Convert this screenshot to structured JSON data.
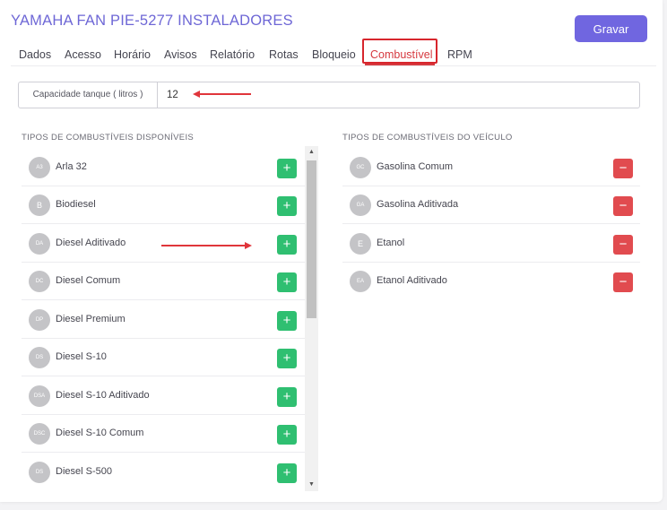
{
  "header": {
    "title": "YAMAHA FAN PIE-5277 INSTALADORES",
    "save_label": "Gravar"
  },
  "tabs": [
    {
      "label": "Dados"
    },
    {
      "label": "Acesso"
    },
    {
      "label": "Horário"
    },
    {
      "label": "Avisos"
    },
    {
      "label": "Relatório"
    },
    {
      "label": "Rotas"
    },
    {
      "label": "Bloqueio"
    },
    {
      "label": "Combustível",
      "active": true
    },
    {
      "label": "RPM"
    }
  ],
  "capacity": {
    "label": "Capacidade tanque ( litros )",
    "value": "12"
  },
  "available": {
    "title": "TIPOS DE COMBUSTÍVEIS DISPONÍVEIS",
    "items": [
      {
        "initials": "A3",
        "name": "Arla 32"
      },
      {
        "initials": "B",
        "name": "Biodiesel"
      },
      {
        "initials": "DA",
        "name": "Diesel Aditivado"
      },
      {
        "initials": "DC",
        "name": "Diesel Comum"
      },
      {
        "initials": "DP",
        "name": "Diesel Premium"
      },
      {
        "initials": "DS",
        "name": "Diesel S-10"
      },
      {
        "initials": "DSA",
        "name": "Diesel S-10 Aditivado"
      },
      {
        "initials": "DSC",
        "name": "Diesel S-10 Comum"
      },
      {
        "initials": "DS",
        "name": "Diesel S-500"
      }
    ],
    "add_symbol": "+"
  },
  "vehicle": {
    "title": "TIPOS DE COMBUSTÍVEIS DO VEÍCULO",
    "items": [
      {
        "initials": "GC",
        "name": "Gasolina Comum"
      },
      {
        "initials": "GA",
        "name": "Gasolina Aditivada"
      },
      {
        "initials": "E",
        "name": "Etanol"
      },
      {
        "initials": "EA",
        "name": "Etanol Aditivado"
      }
    ],
    "remove_symbol": "−"
  },
  "colors": {
    "accent": "#7066e0",
    "add": "#2fbf71",
    "remove": "#e14b4f",
    "annotation": "#e0353b"
  },
  "icons": {
    "scroll_up": "▲",
    "scroll_down": "▼"
  }
}
